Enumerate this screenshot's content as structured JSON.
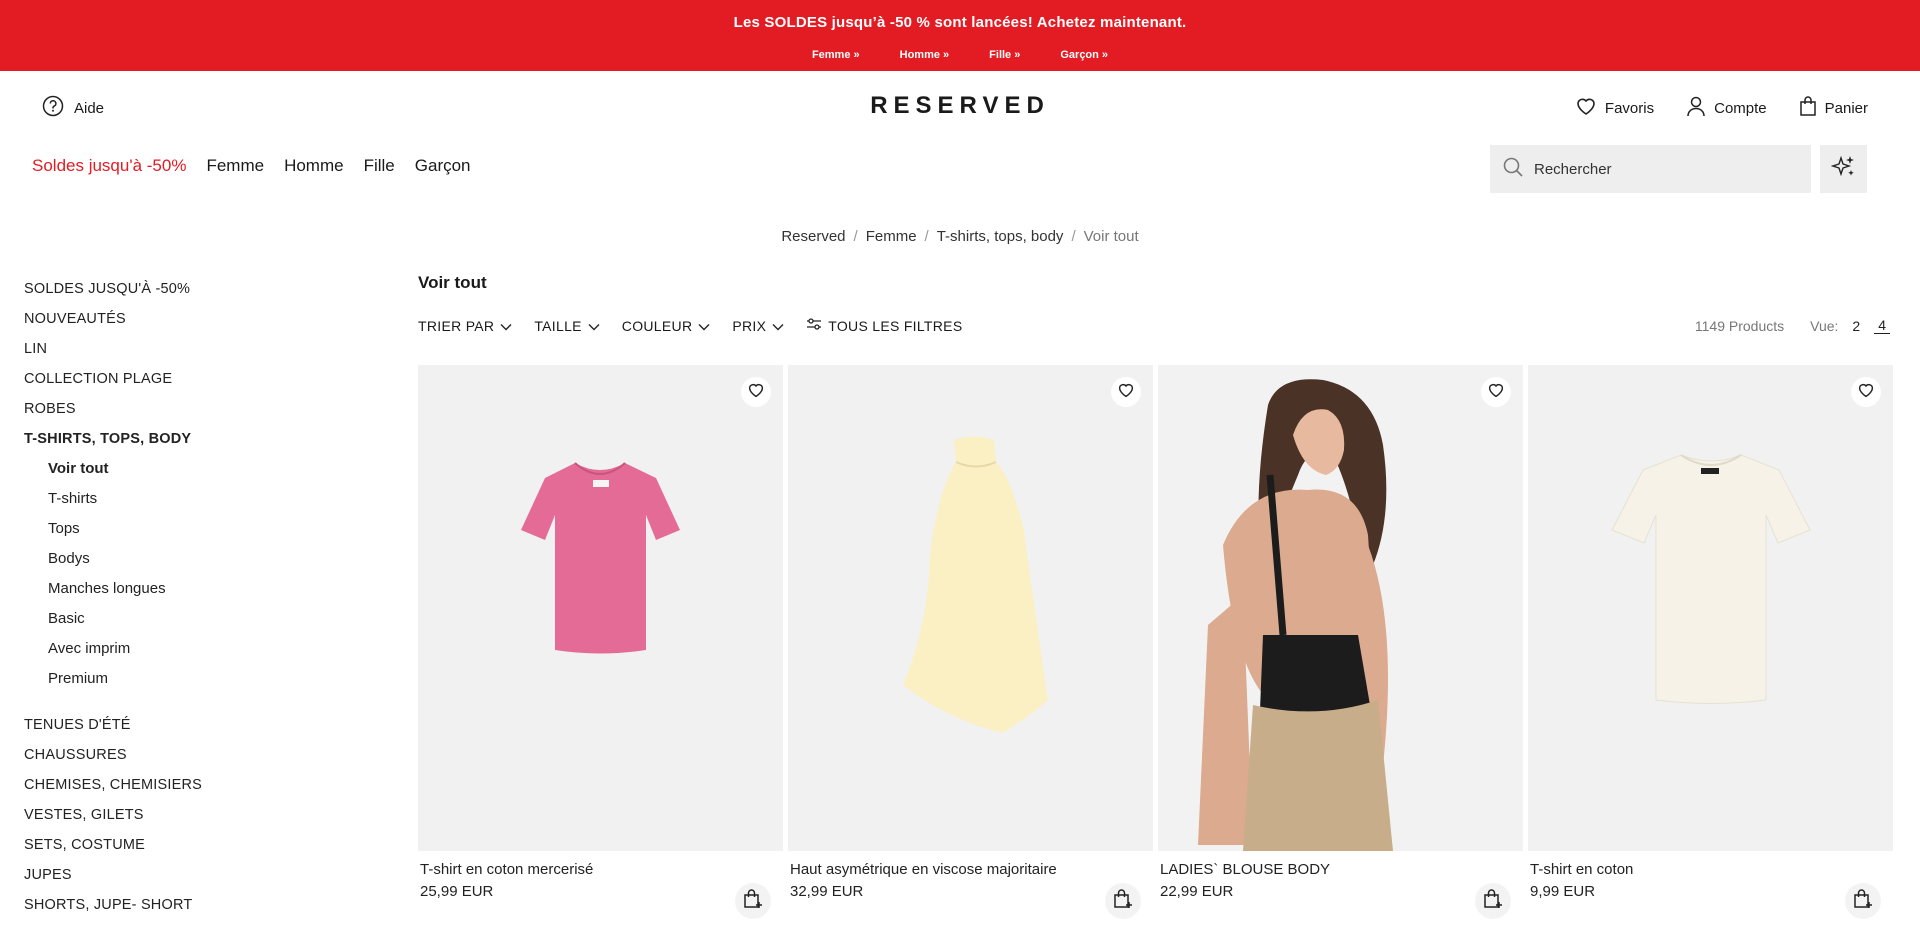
{
  "promo": {
    "title": "Les SOLDES jusqu’à -50 % sont lancées! Achetez maintenant.",
    "links": [
      "Femme »",
      "Homme »",
      "Fille »",
      "Garçon »"
    ]
  },
  "header": {
    "help_label": "Aide",
    "logo": "RESERVED",
    "favorites_label": "Favoris",
    "account_label": "Compte",
    "cart_label": "Panier"
  },
  "nav": {
    "sale": "Soldes jusqu'à -50%",
    "items": [
      "Femme",
      "Homme",
      "Fille",
      "Garçon"
    ]
  },
  "search": {
    "placeholder": "Rechercher"
  },
  "breadcrumb": [
    "Reserved",
    "Femme",
    "T-shirts, tops, body",
    "Voir tout"
  ],
  "sidebar": {
    "categories_top": [
      "SOLDES JUSQU'À -50%",
      "NOUVEAUTÉS",
      "LIN",
      "COLLECTION PLAGE",
      "ROBES",
      "T-SHIRTS, TOPS, BODY"
    ],
    "subcategories": [
      "Voir tout",
      "T-shirts",
      "Tops",
      "Bodys",
      "Manches longues",
      "Basic",
      "Avec imprim",
      "Premium"
    ],
    "categories_bottom": [
      "TENUES D'ÉTÉ",
      "CHAUSSURES",
      "CHEMISES, CHEMISIERS",
      "VESTES, GILETS",
      "SETS, COSTUME",
      "JUPES",
      "SHORTS, JUPE- SHORT"
    ]
  },
  "listing": {
    "title": "Voir tout",
    "filters": [
      "TRIER PAR",
      "TAILLE",
      "COULEUR",
      "PRIX"
    ],
    "all_filters": "TOUS LES FILTRES",
    "count": "1149 Products",
    "view_label": "Vue:",
    "view_options": [
      "2",
      "4"
    ],
    "view_selected": "4"
  },
  "products": [
    {
      "name": "T-shirt en coton mercerisé",
      "price": "25,99 EUR",
      "color": "#e46b96"
    },
    {
      "name": "Haut asymétrique en viscose majoritaire",
      "price": "32,99 EUR",
      "color": "#fbefc4"
    },
    {
      "name": "LADIES` BLOUSE BODY",
      "price": "22,99 EUR",
      "color": "#1c1c1c"
    },
    {
      "name": "T-shirt en coton",
      "price": "9,99 EUR",
      "color": "#f6f2e8"
    }
  ],
  "colors": {
    "accent": "#e31b23",
    "search_bg": "#eeeeee"
  }
}
